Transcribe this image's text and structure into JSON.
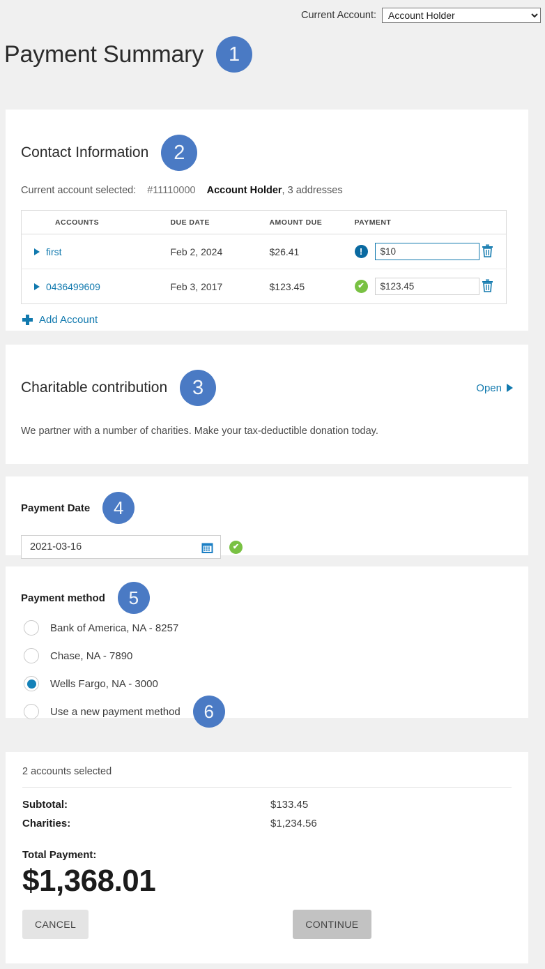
{
  "topbar": {
    "label": "Current Account:",
    "selected_account": "Account Holder",
    "options": [
      "Account Holder"
    ]
  },
  "header": {
    "title": "Payment Summary",
    "badge": "1"
  },
  "contact": {
    "title": "Contact Information",
    "badge": "2",
    "selected_label": "Current account selected:",
    "account_number": "#11110000",
    "account_holder": "Account Holder",
    "addresses": ", 3 addresses",
    "columns": [
      "ACCOUNTS",
      "DUE DATE",
      "AMOUNT DUE",
      "PAYMENT"
    ],
    "rows": [
      {
        "account": "first",
        "due_date": "Feb 2, 2024",
        "amount_due": "$26.41",
        "payment_value": "$10",
        "status": "warning",
        "status_glyph": "!"
      },
      {
        "account": "0436499609",
        "due_date": "Feb 3, 2017",
        "amount_due": "$123.45",
        "payment_value": "$123.45",
        "status": "ok",
        "status_glyph": "✔"
      }
    ],
    "add_account_label": "Add Account"
  },
  "charity": {
    "title": "Charitable contribution",
    "badge": "3",
    "open_label": "Open",
    "description": "We partner with a number of charities. Make your tax-deductible donation today."
  },
  "payment_date": {
    "title": "Payment Date",
    "badge": "4",
    "value": "2021-03-16",
    "valid_glyph": "✔"
  },
  "payment_method": {
    "title": "Payment method",
    "badge": "5",
    "badge_new": "6",
    "options": [
      {
        "label": "Bank of America, NA - 8257",
        "selected": false
      },
      {
        "label": "Chase, NA - 7890",
        "selected": false
      },
      {
        "label": "Wells Fargo, NA - 3000",
        "selected": true
      },
      {
        "label": "Use a new payment method",
        "selected": false
      }
    ]
  },
  "totals": {
    "accounts_selected": "2 accounts selected",
    "subtotal_label": "Subtotal:",
    "subtotal_value": "$133.45",
    "charities_label": "Charities:",
    "charities_value": "$1,234.56",
    "total_label": "Total Payment:",
    "total_value": "$1,368.01",
    "cancel_label": "CANCEL",
    "continue_label": "CONTINUE"
  },
  "colors": {
    "badge_blue": "#4a7ac4",
    "link_blue": "#1179ae",
    "status_ok_green": "#79c143",
    "status_warn_blue": "#0a6aa1",
    "page_background": "#f0f0f0",
    "card_background": "#ffffff"
  }
}
